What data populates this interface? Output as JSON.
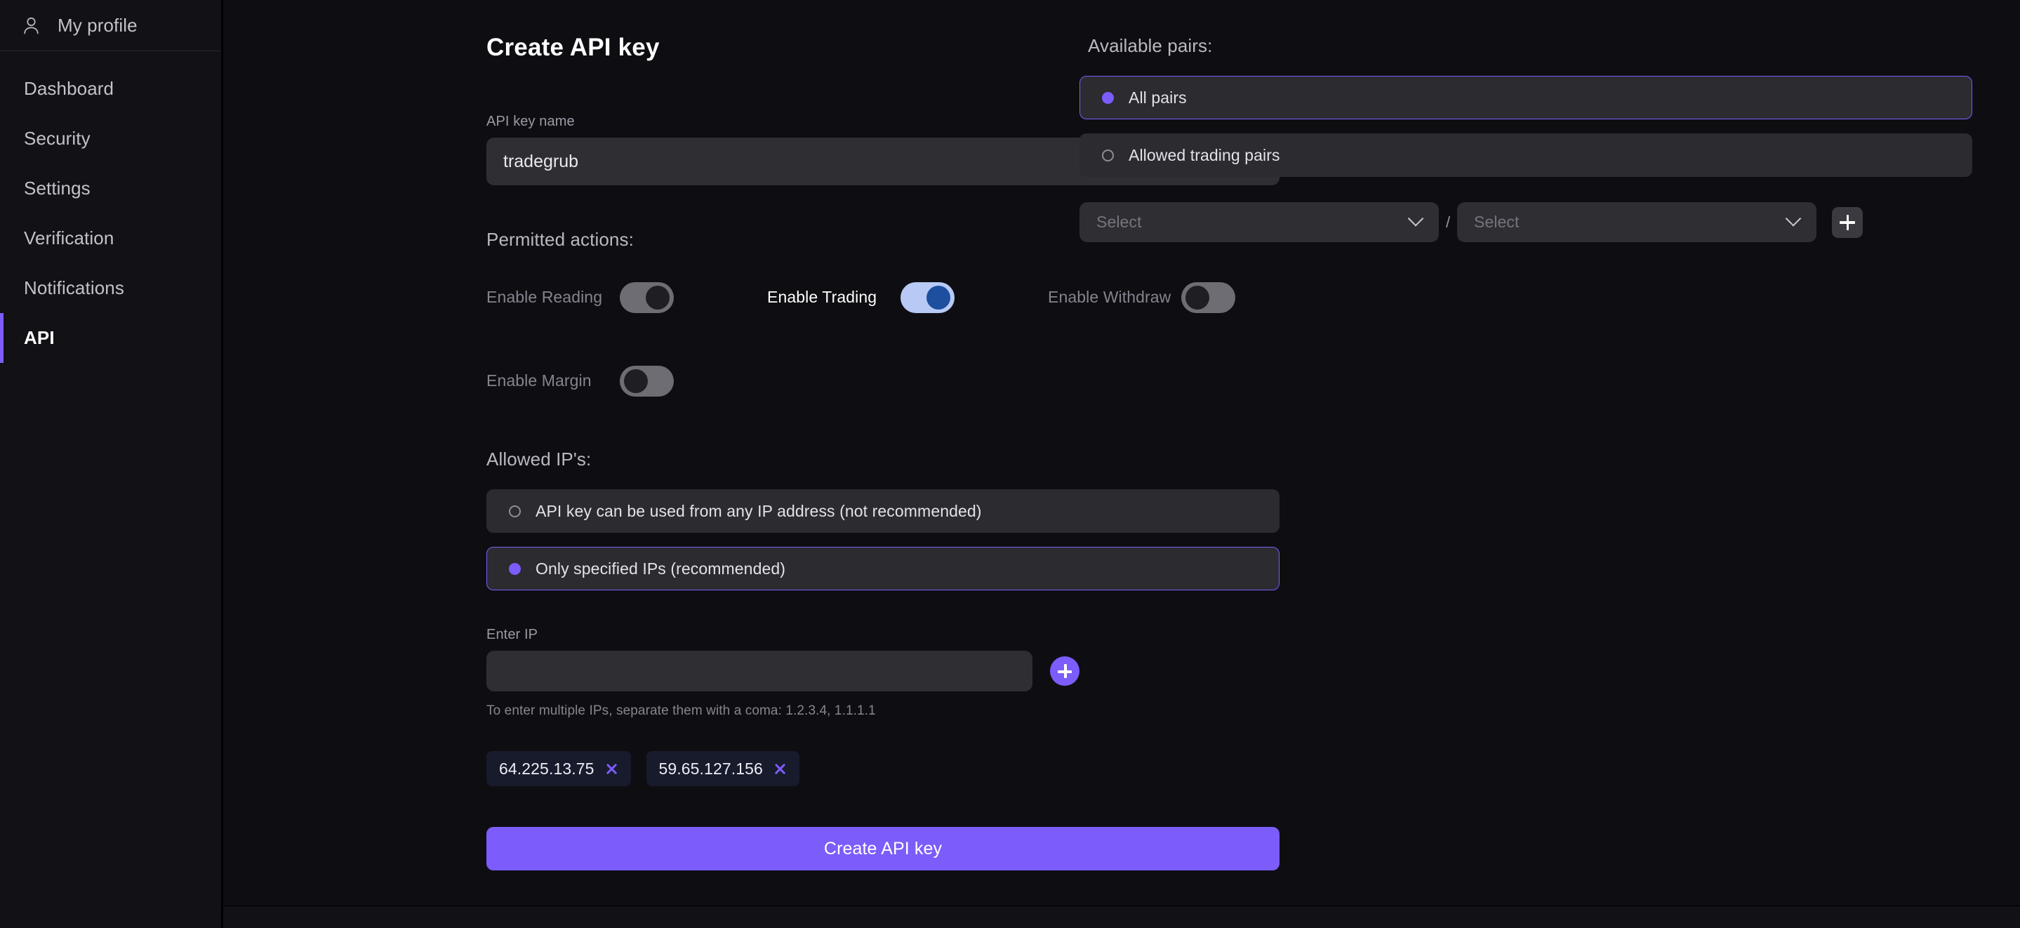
{
  "sidebar": {
    "profile": {
      "label": "My profile",
      "icon": "user-icon"
    },
    "items": [
      {
        "label": "Dashboard",
        "active": false
      },
      {
        "label": "Security",
        "active": false
      },
      {
        "label": "Settings",
        "active": false
      },
      {
        "label": "Verification",
        "active": false
      },
      {
        "label": "Notifications",
        "active": false
      },
      {
        "label": "API",
        "active": true
      }
    ]
  },
  "main": {
    "title": "Create API key",
    "api_key_name": {
      "label": "API key name",
      "value": "tradegrub",
      "placeholder": ""
    },
    "permitted_actions": {
      "label": "Permitted actions:",
      "toggles": [
        {
          "label": "Enable Reading",
          "state": "disabled-on"
        },
        {
          "label": "Enable Trading",
          "state": "on"
        },
        {
          "label": "Enable Withdraw",
          "state": "off"
        },
        {
          "label": "Enable Margin",
          "state": "off"
        }
      ]
    },
    "allowed_ips": {
      "label": "Allowed IP's:",
      "options": [
        {
          "label": "API key can be used from any IP address (not recommended)",
          "selected": false
        },
        {
          "label": "Only specified IPs (recommended)",
          "selected": true
        }
      ],
      "enter_ip_label": "Enter IP",
      "enter_ip_value": "",
      "enter_ip_placeholder": "",
      "add_icon": "plus-icon",
      "hint": "To enter multiple IPs, separate them with a coma: 1.2.3.4, 1.1.1.1",
      "tags": [
        {
          "value": "64.225.13.75",
          "remove_icon": "close-icon"
        },
        {
          "value": "59.65.127.156",
          "remove_icon": "close-icon"
        }
      ]
    },
    "submit_label": "Create API key"
  },
  "pairs": {
    "label": "Available pairs:",
    "options": [
      {
        "label": "All pairs",
        "selected": true
      },
      {
        "label": "Allowed trading pairs",
        "selected": false
      }
    ],
    "selects": [
      {
        "placeholder": "Select",
        "value": "",
        "chevron": "chevron-down-icon"
      },
      {
        "placeholder": "Select",
        "value": "",
        "chevron": "chevron-down-icon"
      }
    ],
    "separator": "/",
    "add_icon": "plus-icon"
  },
  "colors": {
    "accent_purple": "#7c5cfa",
    "toggle_on_track": "#b8c9f5",
    "toggle_on_knob": "#1d4f9e",
    "toggle_off_track": "#6d6d73",
    "page_bg": "#0e0e12",
    "sidebar_bg": "#111116",
    "input_bg": "#2e2e33",
    "row_bg": "#2b2b30",
    "tag_bg": "#171b2c"
  }
}
